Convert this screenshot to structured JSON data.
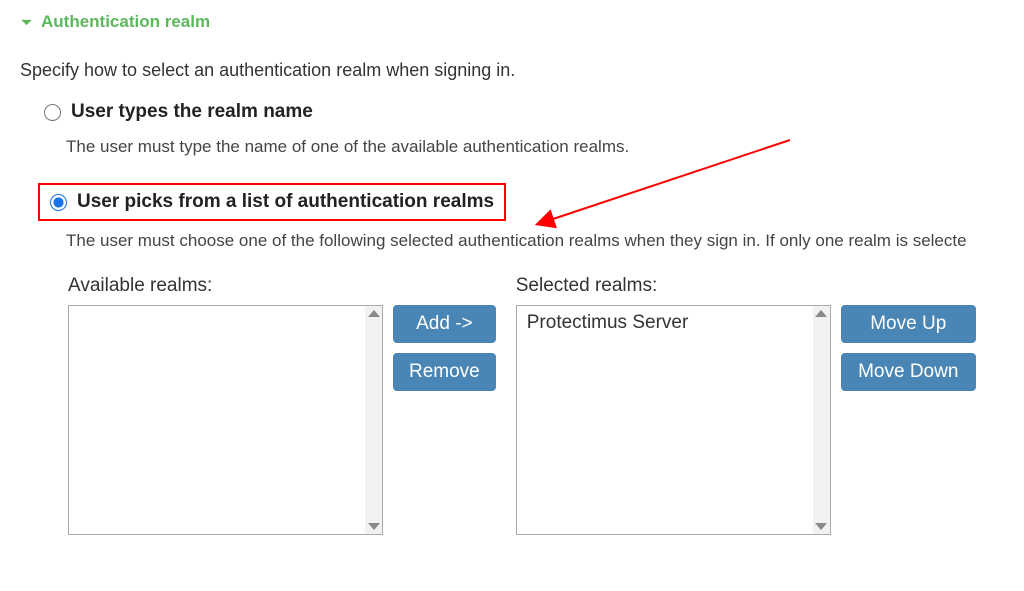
{
  "section": {
    "title": "Authentication realm"
  },
  "intro": "Specify how to select an authentication realm when signing in.",
  "options": {
    "types": {
      "label": "User types the realm name",
      "desc": "The user must type the name of one of the available authentication realms."
    },
    "picks": {
      "label": "User picks from a list of authentication realms",
      "desc": "The user must choose one of the following selected authentication realms when they sign in. If only one realm is selecte"
    }
  },
  "picker": {
    "available_label": "Available realms:",
    "selected_label": "Selected realms:",
    "selected_items": [
      "Protectimus Server"
    ],
    "buttons": {
      "add": "Add ->",
      "remove": "Remove",
      "up": "Move Up",
      "down": "Move Down"
    }
  }
}
